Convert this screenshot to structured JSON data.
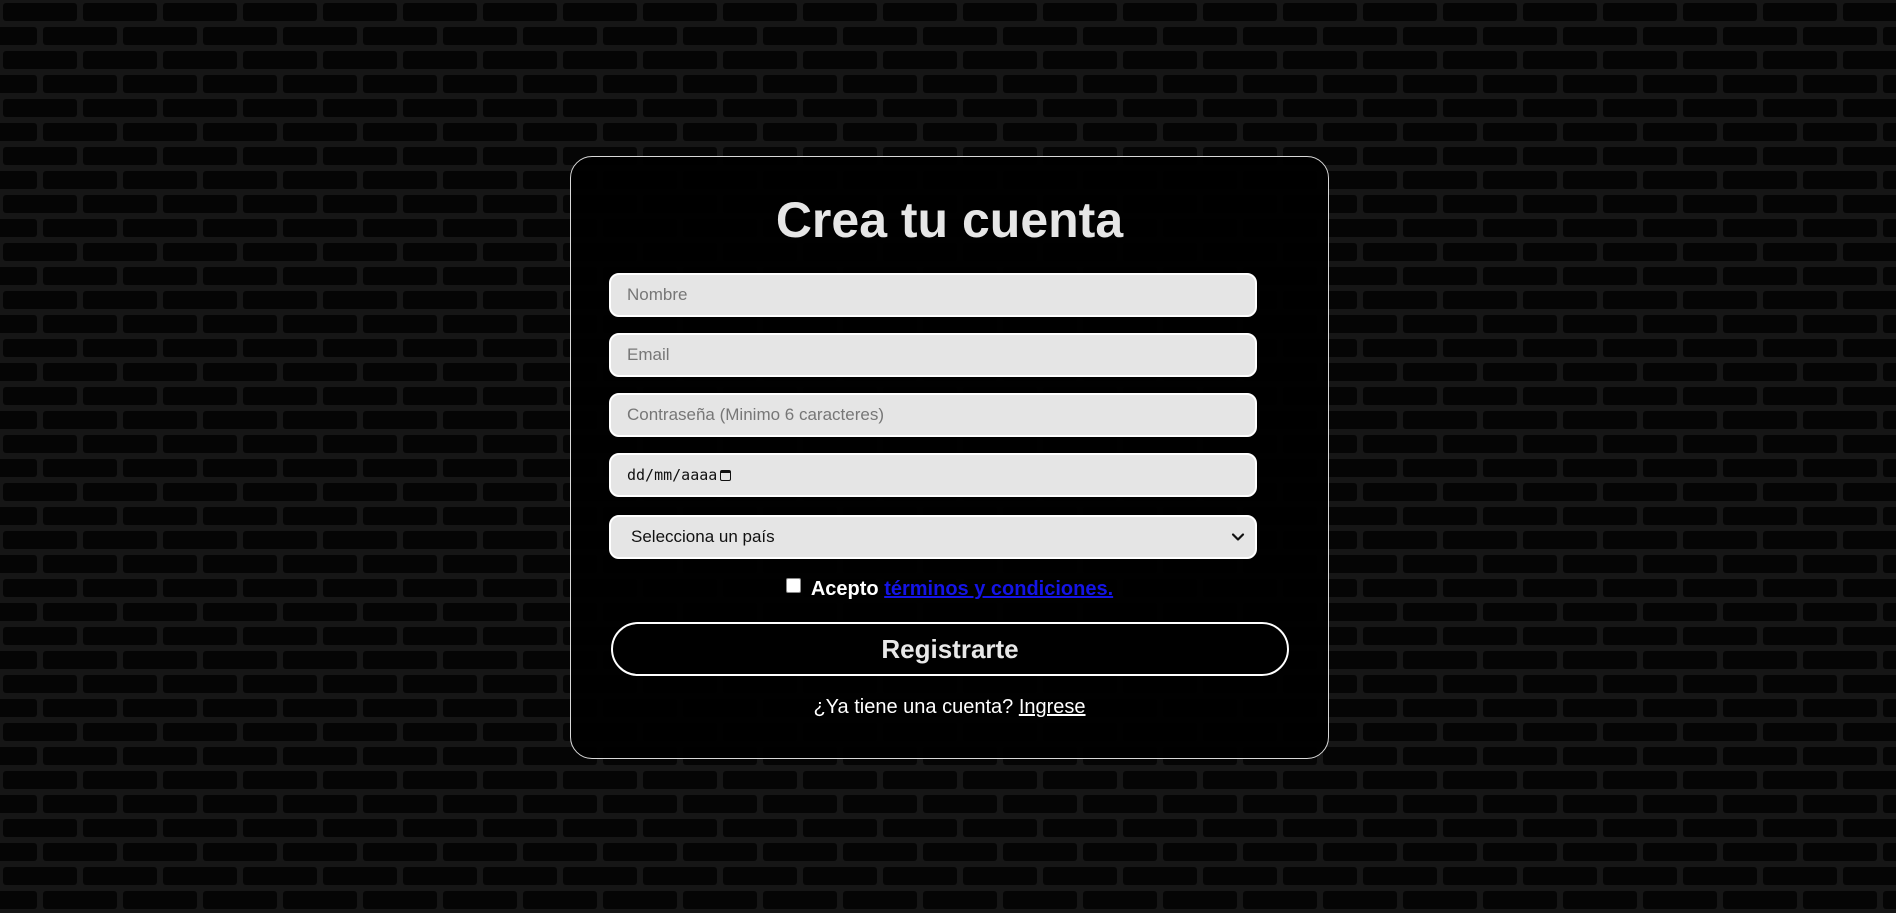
{
  "form": {
    "title": "Crea tu cuenta",
    "name_placeholder": "Nombre",
    "email_placeholder": "Email",
    "password_placeholder": "Contraseña (Minimo 6 caracteres)",
    "date_format": "dd/mm/aaaa",
    "country_selected": "Selecciona un país",
    "terms_prefix": "Acepto",
    "terms_link": "términos y condiciones.",
    "terms_checked": false,
    "submit_label": "Registrarte",
    "login_prompt": "¿Ya tiene una cuenta?",
    "login_link": "Ingrese"
  },
  "colors": {
    "background": "#0b0b0b",
    "card_border": "#d8d8d8",
    "input_bg": "#e5e5e5",
    "link": "#1414e6",
    "text": "#ffffff"
  },
  "icons": {
    "date": "calendar-icon",
    "select": "chevron-down-icon"
  }
}
